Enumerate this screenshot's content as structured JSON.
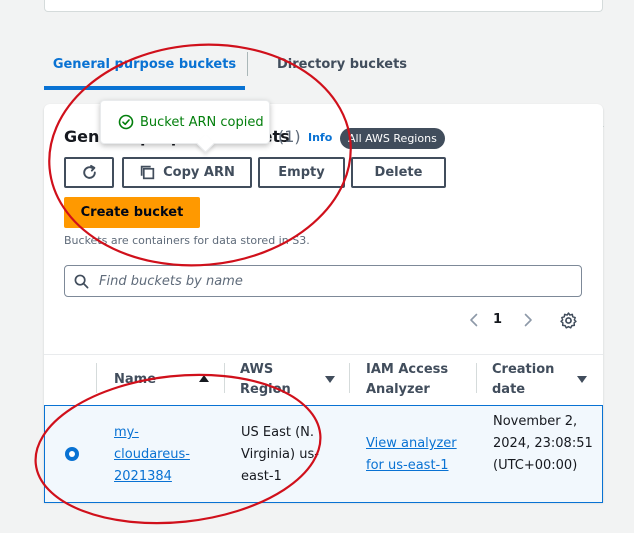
{
  "tabs": [
    {
      "label": "General purpose buckets"
    },
    {
      "label": "Directory buckets"
    }
  ],
  "panel": {
    "heading": "General purpose buckets",
    "count": "(1)",
    "info_label": "Info",
    "region_badge": "All AWS Regions"
  },
  "toast": {
    "message": "Bucket ARN copied"
  },
  "actions": {
    "copy_arn": "Copy ARN",
    "empty": "Empty",
    "delete": "Delete",
    "create": "Create bucket"
  },
  "description": "Buckets are containers for data stored in S3.",
  "search": {
    "placeholder": "Find buckets by name"
  },
  "pagination": {
    "current_page": "1"
  },
  "table": {
    "columns": {
      "name": "Name",
      "region_line1": "AWS",
      "region_line2": "Region",
      "iam_line1": "IAM Access",
      "iam_line2": "Analyzer",
      "date_line1": "Creation",
      "date_line2": "date"
    },
    "rows": [
      {
        "name": "my-cloudareus-2021384",
        "region": "US East (N. Virginia) us-east-1",
        "iam": "View analyzer for us-east-1",
        "created": "November 2, 2024, 23:08:51 (UTC+00:00)"
      }
    ]
  },
  "colors": {
    "accent": "#0972d3",
    "primary_button": "#ff9900",
    "success": "#037f0c",
    "annotation": "#d0101b"
  },
  "icons": [
    "refresh-icon",
    "copy-icon",
    "check-circle-icon",
    "search-icon",
    "chevron-left-icon",
    "chevron-right-icon",
    "settings-icon",
    "sort-ascending-icon",
    "sort-descending-icon"
  ]
}
